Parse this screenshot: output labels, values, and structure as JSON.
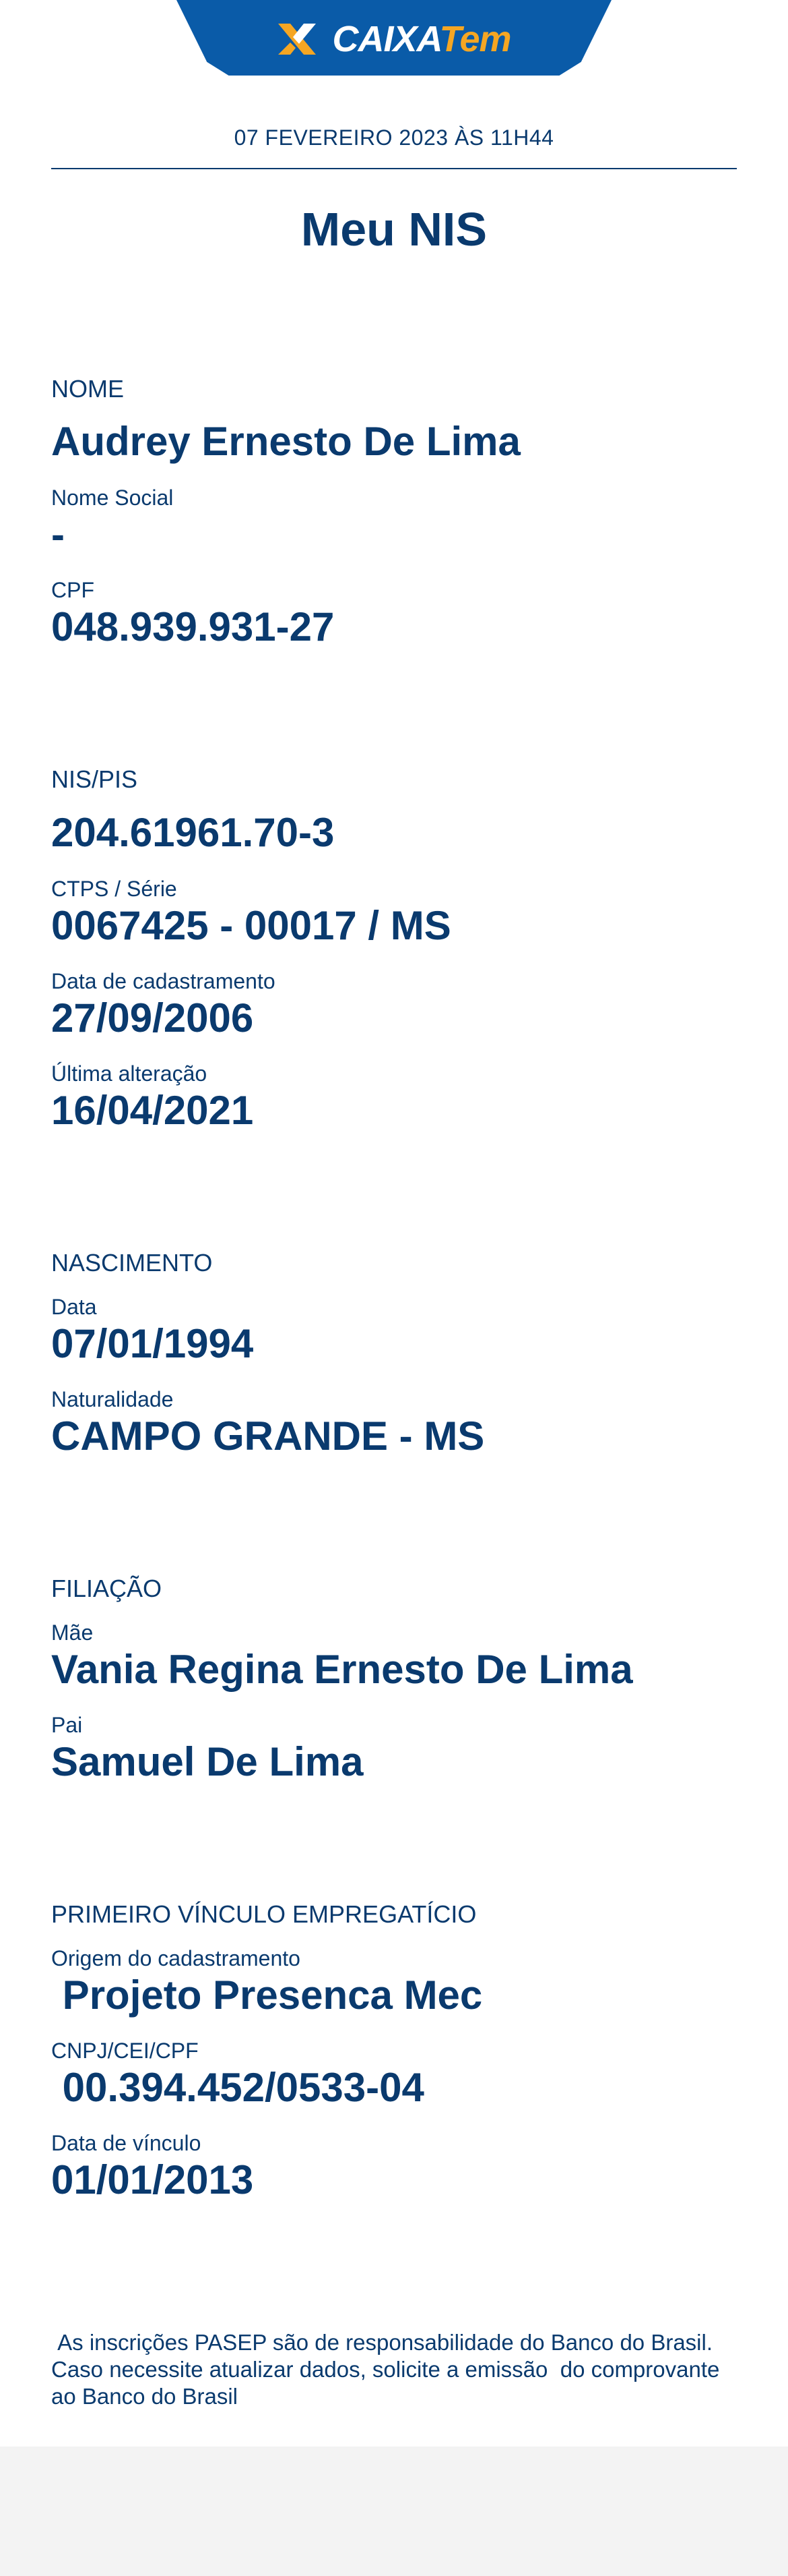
{
  "header": {
    "logo_icon": "x-logo-icon",
    "brand_caixa": "CAIXA",
    "brand_tem": "Tem",
    "bg_color": "#0a5ba8",
    "accent_color": "#f5a623"
  },
  "timestamp": "07 FEVEREIRO 2023 ÀS 11H44",
  "title": "Meu NIS",
  "sections": {
    "nome": {
      "title": "NOME",
      "full_name": "Audrey Ernesto De Lima",
      "social_label": "Nome Social",
      "social_value": "-",
      "cpf_label": "CPF",
      "cpf_value": "048.939.931-27"
    },
    "nis": {
      "title": "NIS/PIS",
      "nis_value": "204.61961.70-3",
      "ctps_label": "CTPS / Série",
      "ctps_value": "0067425 - 00017 / MS",
      "cadastro_label": "Data de cadastramento",
      "cadastro_value": "27/09/2006",
      "alteracao_label": "Última alteração",
      "alteracao_value": "16/04/2021"
    },
    "nascimento": {
      "title": "NASCIMENTO",
      "data_label": "Data",
      "data_value": "07/01/1994",
      "naturalidade_label": "Naturalidade",
      "naturalidade_value": "CAMPO GRANDE - MS"
    },
    "filiacao": {
      "title": "FILIAÇÃO",
      "mae_label": "Mãe",
      "mae_value": "Vania Regina Ernesto De Lima",
      "pai_label": "Pai",
      "pai_value": "Samuel De Lima"
    },
    "vinculo": {
      "title": "PRIMEIRO VÍNCULO EMPREGATÍCIO",
      "origem_label": "Origem do cadastramento",
      "origem_value": " Projeto Presenca Mec",
      "cnpj_label": "CNPJ/CEI/CPF",
      "cnpj_value": " 00.394.452/0533-04",
      "vinculo_label": "Data de vínculo",
      "vinculo_value": "01/01/2013"
    }
  },
  "footer_note": " As inscrições PASEP são de responsabilidade do Banco do Brasil. Caso necessite atualizar dados, solicite a emissão  do comprovante ao Banco do Brasil"
}
